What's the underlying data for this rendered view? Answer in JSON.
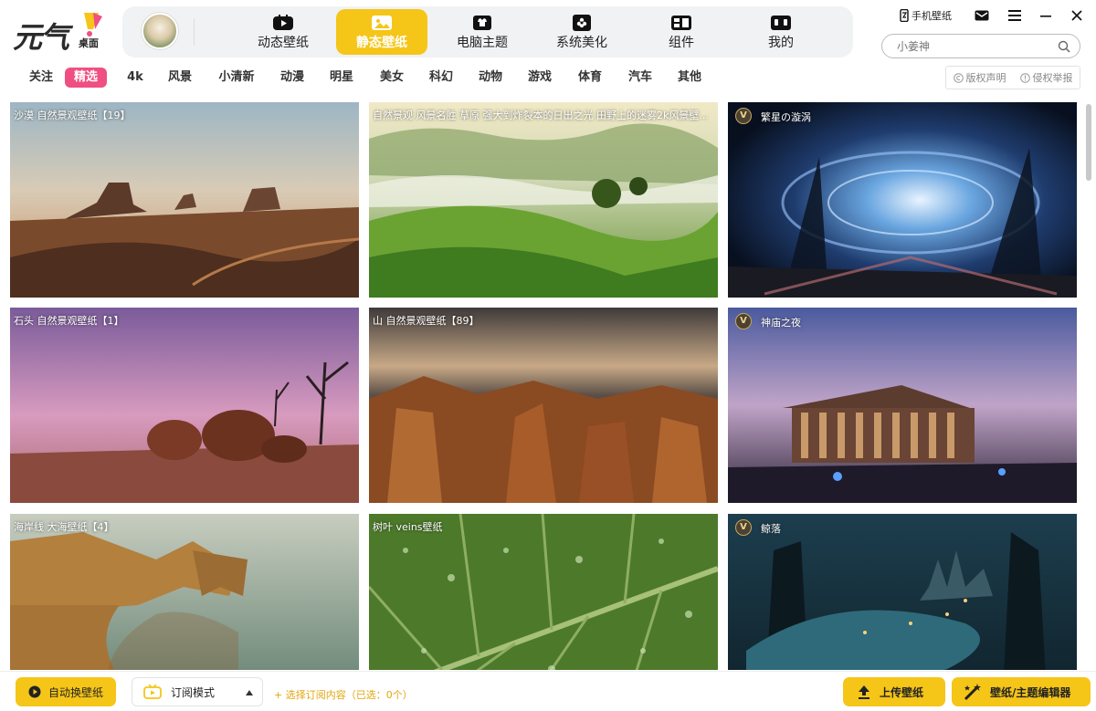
{
  "app": {
    "logo_text": "元气",
    "logo_sub": "桌面"
  },
  "nav": {
    "tabs": [
      {
        "label": "动态壁纸",
        "icon": "play-icon"
      },
      {
        "label": "静态壁纸",
        "icon": "image-icon",
        "active": true
      },
      {
        "label": "电脑主题",
        "icon": "shirt-icon"
      },
      {
        "label": "系统美化",
        "icon": "flower-icon"
      },
      {
        "label": "组件",
        "icon": "widget-icon"
      },
      {
        "label": "我的",
        "icon": "profile-icon"
      }
    ]
  },
  "top_right": {
    "mobile_wallpaper": "手机壁纸"
  },
  "search": {
    "placeholder": "小姜神"
  },
  "categories": [
    {
      "label": "关注"
    },
    {
      "label": "精选",
      "active": true
    },
    {
      "label": "4k"
    },
    {
      "label": "风景"
    },
    {
      "label": "小清新"
    },
    {
      "label": "动漫"
    },
    {
      "label": "明星"
    },
    {
      "label": "美女"
    },
    {
      "label": "科幻"
    },
    {
      "label": "动物"
    },
    {
      "label": "游戏"
    },
    {
      "label": "体育"
    },
    {
      "label": "汽车"
    },
    {
      "label": "其他"
    }
  ],
  "cat_tools": {
    "copyright": "版权声明",
    "report": "侵权举报"
  },
  "cards": [
    {
      "title": "沙漠 自然景观壁纸【19】",
      "vip": false
    },
    {
      "title": "自然景观 风景名胜 草原 强大到炸裂本的日出之光 田野上的迷雾2k风景壁...",
      "vip": false
    },
    {
      "title": "繁星の漩涡",
      "vip": true
    },
    {
      "title": "石头 自然景观壁纸【1】",
      "vip": false
    },
    {
      "title": "山 自然景观壁纸【89】",
      "vip": false
    },
    {
      "title": "神庙之夜",
      "vip": true
    },
    {
      "title": "海岸线 大海壁纸【4】",
      "vip": false
    },
    {
      "title": "树叶 veins壁纸",
      "vip": false
    },
    {
      "title": "鲸落",
      "vip": true
    }
  ],
  "vip_badge": "V",
  "bottom": {
    "auto_change": "自动换壁纸",
    "sub_mode": "订阅模式",
    "select_sub": "+ 选择订阅内容（已选：0个）",
    "upload": "上传壁纸",
    "editor": "壁纸/主题编辑器"
  }
}
